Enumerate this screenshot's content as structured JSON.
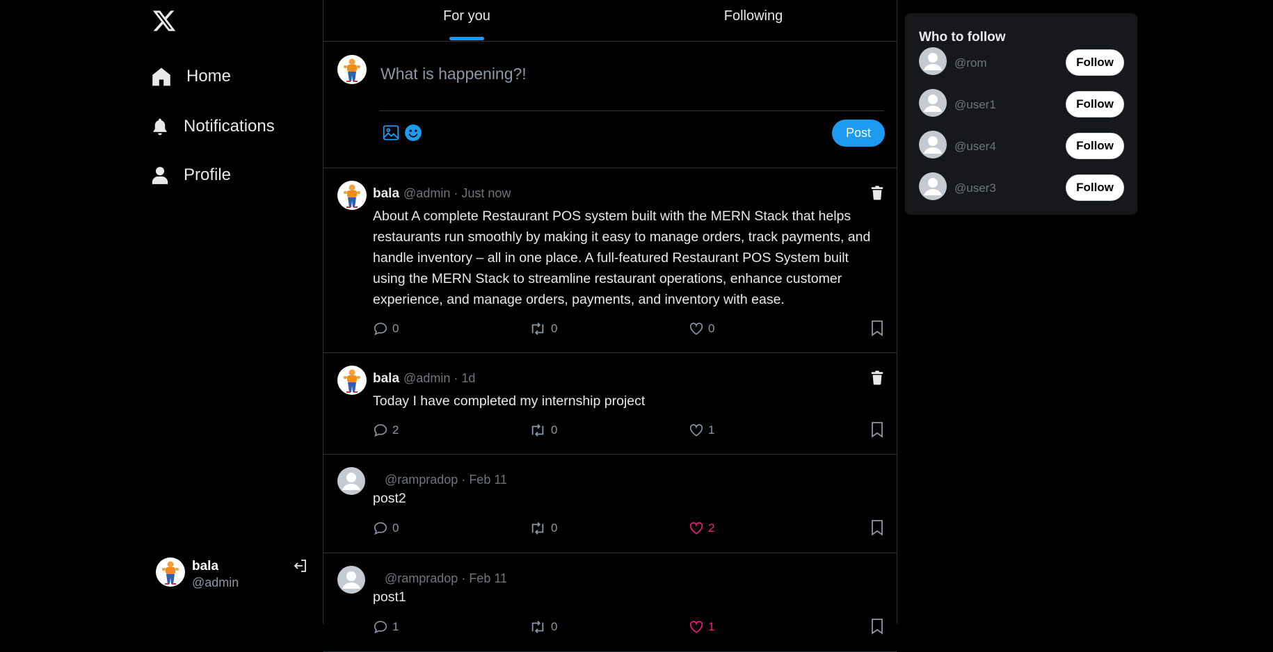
{
  "sidebar": {
    "logo_icon": "x-logo-icon",
    "items": [
      {
        "label": "Home",
        "icon": "home-icon"
      },
      {
        "label": "Notifications",
        "icon": "bell-icon"
      },
      {
        "label": "Profile",
        "icon": "user-icon"
      }
    ],
    "user": {
      "name": "bala",
      "handle": "@admin"
    }
  },
  "tabs": [
    {
      "label": "For you",
      "active": true
    },
    {
      "label": "Following",
      "active": false
    }
  ],
  "compose": {
    "placeholder": "What is happening?!",
    "post_label": "Post"
  },
  "posts": [
    {
      "name": "bala",
      "meta": "@admin · Just now",
      "text": "About A complete Restaurant POS system built with the MERN Stack that helps restaurants run smoothly by making it easy to manage orders, track payments, and handle inventory – all in one place. A full-featured Restaurant POS System built using the MERN Stack to streamline restaurant operations, enhance customer experience, and manage orders, payments, and inventory with ease.",
      "comments": "0",
      "reposts": "0",
      "likes": "0",
      "liked": false
    },
    {
      "name": "bala",
      "meta": "@admin · 1d",
      "text": "Today I have completed my internship project",
      "comments": "2",
      "reposts": "0",
      "likes": "1",
      "liked": false
    },
    {
      "name": "",
      "meta": "@rampradop · Feb 11",
      "text": "post2",
      "comments": "0",
      "reposts": "0",
      "likes": "2",
      "liked": true
    },
    {
      "name": "",
      "meta": "@rampradop · Feb 11",
      "text": "post1",
      "comments": "1",
      "reposts": "0",
      "likes": "1",
      "liked": true
    }
  ],
  "who_to_follow": {
    "title": "Who to follow",
    "users": [
      {
        "handle": "@rom",
        "button": "Follow"
      },
      {
        "handle": "@user1",
        "button": "Follow"
      },
      {
        "handle": "@user4",
        "button": "Follow"
      },
      {
        "handle": "@user3",
        "button": "Follow"
      }
    ]
  },
  "colors": {
    "background": "#000000",
    "accent": "#1d9bf0",
    "like": "#f91880",
    "border": "#2f3336",
    "panel": "#16181c"
  }
}
